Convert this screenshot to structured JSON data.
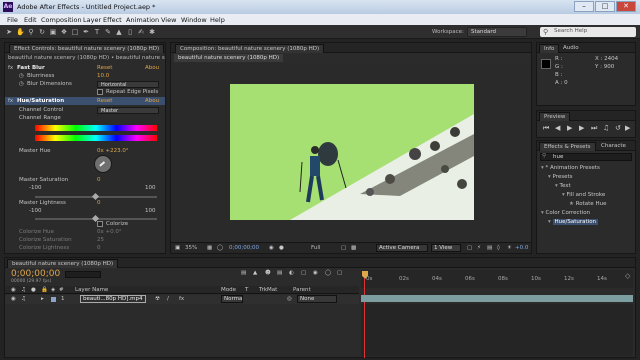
{
  "window": {
    "app_icon_label": "Ae",
    "title": "Adobe After Effects - Untitled Project.aep *",
    "min_label": "–",
    "max_label": "□",
    "close_label": "✕"
  },
  "menu": [
    "File",
    "Edit",
    "Composition",
    "Layer",
    "Effect",
    "Animation",
    "View",
    "Window",
    "Help"
  ],
  "toolbar": {
    "workspace_label": "Workspace:",
    "workspace_value": "Standard",
    "search_placeholder": "Search Help"
  },
  "effect_controls": {
    "tab_label": "Effect Controls: beautiful nature scenery (1080p HD)",
    "header": "beautiful nature scenery (1080p HD) • beautiful nature scenery (1080p...",
    "fast_blur": {
      "name": "Fast Blur",
      "reset": "Reset",
      "about": "Abou",
      "blurriness_label": "Blurriness",
      "blurriness_value": "10.0",
      "dimensions_label": "Blur Dimensions",
      "dimensions_value": "Horizontal",
      "repeat_label": "Repeat Edge Pixels"
    },
    "hue_sat": {
      "name": "Hue/Saturation",
      "reset": "Reset",
      "about": "Abou",
      "channel_control_label": "Channel Control",
      "channel_control_value": "Master",
      "channel_range_label": "Channel Range",
      "master_hue_label": "Master Hue",
      "master_hue_value": "0x +223.0°",
      "master_sat_label": "Master Saturation",
      "master_sat_value": "0",
      "sat_min": "-100",
      "sat_max": "100",
      "master_light_label": "Master Lightness",
      "master_light_value": "0",
      "light_min": "-100",
      "light_max": "100",
      "colorize_label": "Colorize",
      "colorize_hue_label": "Colorize Hue",
      "colorize_hue_value": "0x +0.0°",
      "colorize_sat_label": "Colorize Saturation",
      "colorize_sat_value": "25",
      "colorize_light_label": "Colorize Lightness",
      "colorize_light_value": "0"
    }
  },
  "composition": {
    "tab_label": "Composition: beautiful nature scenery (1080p HD)",
    "subtab_label": "beautiful nature scenery (1080p HD)",
    "zoom": "35%",
    "timecode": "0;00;00;00",
    "resolution": "Full",
    "camera": "Active Camera",
    "views": "1 View",
    "exposure": "+0.0"
  },
  "info": {
    "tab_info": "Info",
    "tab_audio": "Audio",
    "r_label": "R :",
    "g_label": "G :",
    "b_label": "B :",
    "a_label": "A : 0",
    "x_label": "X : 2404",
    "y_label": "Y : 900"
  },
  "preview": {
    "tab_label": "Preview"
  },
  "effects_presets": {
    "tab_label": "Effects & Presets",
    "tab_character": "Characte",
    "search_value": "hue",
    "items": [
      {
        "label": "* Animation Presets",
        "indent": 0
      },
      {
        "label": "Presets",
        "indent": 1
      },
      {
        "label": "Text",
        "indent": 2
      },
      {
        "label": "Fill and Stroke",
        "indent": 3
      },
      {
        "label": "Rotate Hue",
        "indent": 4
      },
      {
        "label": "Color Correction",
        "indent": 0
      },
      {
        "label": "Hue/Saturation",
        "indent": 1
      }
    ]
  },
  "timeline": {
    "tab_label": "beautiful nature scenery (1080p HD)",
    "timecode": "0;00;00;00",
    "frame_info": "00000 (29.97 fps)",
    "search_placeholder": "",
    "col_layer_name": "Layer Name",
    "col_mode": "Mode",
    "col_t": "T",
    "col_trkmat": "TrkMat",
    "col_parent": "Parent",
    "layer_index": "1",
    "layer_name": "beauti...80p HD].mp4",
    "layer_mode": "Norma",
    "layer_parent": "None",
    "ruler": [
      "0s",
      "02s",
      "04s",
      "06s",
      "08s",
      "10s",
      "12s",
      "14s"
    ]
  }
}
